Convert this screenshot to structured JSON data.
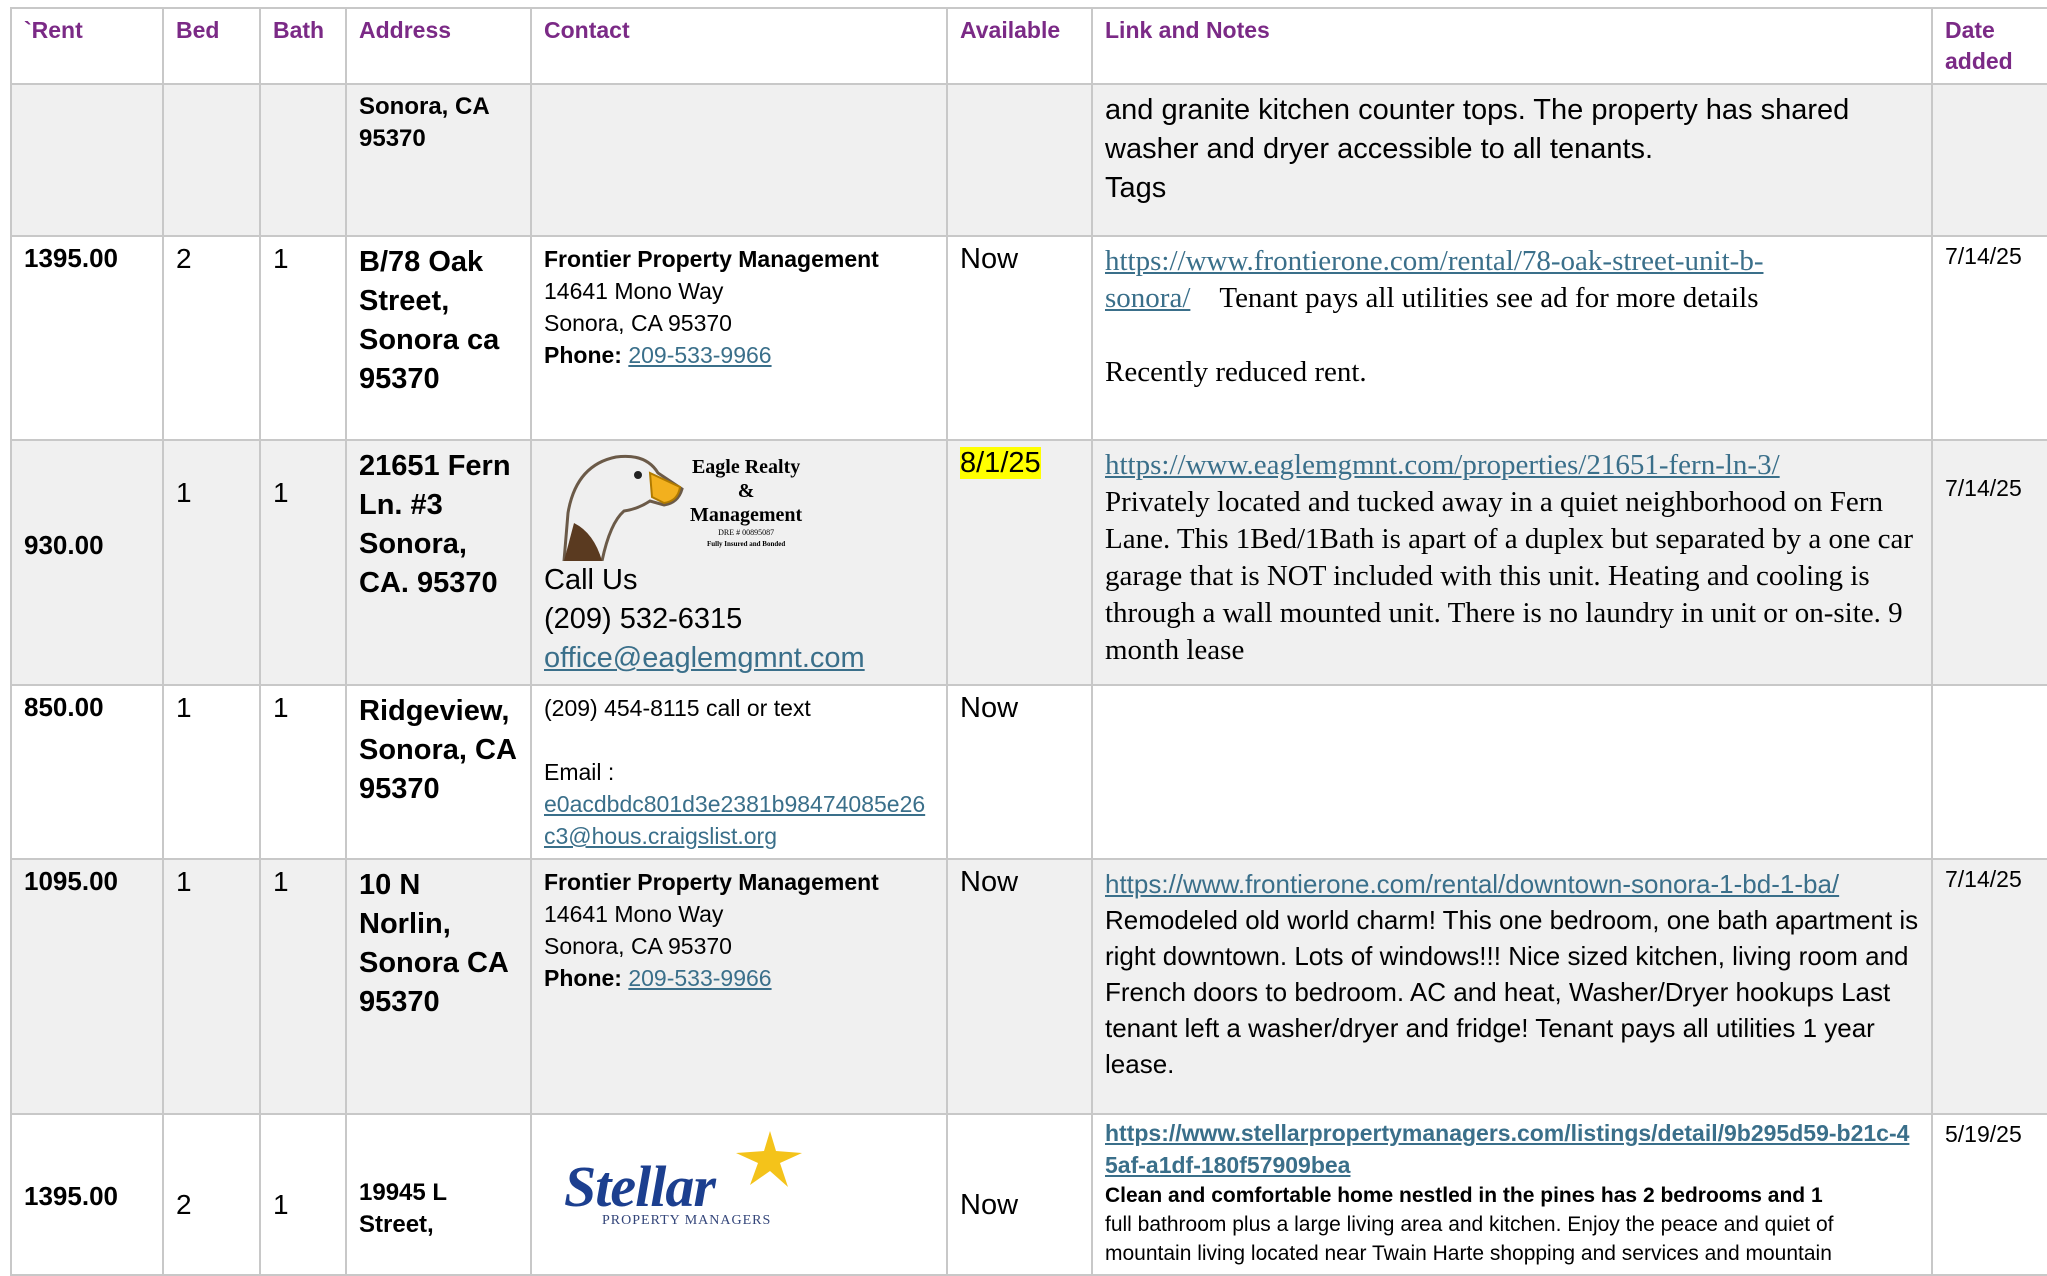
{
  "headers": {
    "rent": "`Rent",
    "bed": "Bed",
    "bath": "Bath",
    "address": "Address",
    "contact": "Contact",
    "available": "Available",
    "notes": "Link and Notes",
    "date": "Date added"
  },
  "row0": {
    "address": "Sonora, CA 95370",
    "notes": "and granite kitchen counter tops. The property has shared washer and dryer accessible to all tenants.",
    "tags": "Tags"
  },
  "row1": {
    "rent": "1395.00",
    "bed": "2",
    "bath": "1",
    "address": "B/78 Oak Street, Sonora ca 95370",
    "company": "Frontier Property Management",
    "street": "14641 Mono Way",
    "city": "Sonora, CA 95370",
    "phone_label": "Phone:",
    "phone": "209-533-9966",
    "available": "Now",
    "link": "https://www.frontierone.com/rental/78-oak-street-unit-b-sonora/",
    "note": "Tenant pays all utilities see ad for more details",
    "note2": "Recently reduced rent.",
    "date": "7/14/25"
  },
  "row2": {
    "rent": "930.00",
    "bed": "1",
    "bath": "1",
    "address": "21651 Fern Ln. #3 Sonora, CA. 95370",
    "logo_title": "Eagle Realty",
    "logo_amp": "&",
    "logo_sub": "Management",
    "logo_dre": "DRE # 00895087",
    "logo_ins": "Fully Insured and Bonded",
    "call": "Call Us",
    "phone": "(209) 532-6315",
    "email": "office@eaglemgmnt.com",
    "available": "8/1/25",
    "link": "https://www.eaglemgmnt.com/properties/21651-fern-ln-3/",
    "note": "Privately located and tucked away in a quiet neighborhood on Fern Lane. This 1Bed/1Bath is apart of a duplex but separated by a one car garage that is NOT included with this unit. Heating and cooling is through a wall mounted unit. There is no laundry in unit or on-site. 9 month lease",
    "date": "7/14/25"
  },
  "row3": {
    "rent": "850.00",
    "bed": "1",
    "bath": "1",
    "address": "Ridgeview, Sonora, CA 95370",
    "phone": "(209) 454-8115 call or text",
    "email_label": "Email :",
    "email": "e0acdbdc801d3e2381b98474085e26c3@hous.craigslist.org",
    "available": "Now"
  },
  "row4": {
    "rent": "1095.00",
    "bed": "1",
    "bath": "1",
    "address": "10 N Norlin, Sonora CA 95370",
    "company": "Frontier Property Management",
    "street": "14641 Mono Way",
    "city": "Sonora, CA 95370",
    "phone_label": "Phone:",
    "phone": "209-533-9966",
    "available": "Now",
    "link": "https://www.frontierone.com/rental/downtown-sonora-1-bd-1-ba/",
    "note": "Remodeled old world charm!  This one bedroom, one bath apartment is right downtown.  Lots of windows!!!  Nice sized kitchen, living room and French doors to bedroom.  AC and heat, Washer/Dryer hookups Last tenant left a washer/dryer and fridge! Tenant pays all utilities 1 year lease.",
    "date": "7/14/25"
  },
  "row5": {
    "rent": "1395.00",
    "bed": "2",
    "bath": "1",
    "address": "19945 L Street,",
    "logo_word": "Stellar",
    "logo_sub": "PROPERTY MANAGERS",
    "available": "Now",
    "link": "https://www.stellarpropertymanagers.com/listings/detail/9b295d59-b21c-45af-a1df-180f57909bea",
    "note_bold": "Clean and comfortable home nestled in the pines has 2 bedrooms and 1",
    "note": "full bathroom plus a large living area and kitchen. Enjoy the peace and quiet of mountain living located near Twain Harte shopping and services and mountain",
    "date": "5/19/25"
  }
}
